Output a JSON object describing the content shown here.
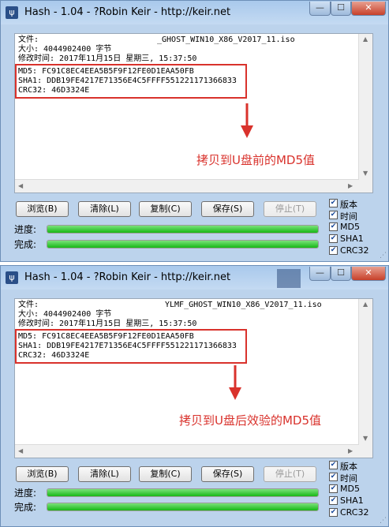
{
  "colors": {
    "annotation": "#d9322c",
    "progress": "#16b816",
    "titlebar": "#b7d1ef"
  },
  "windows": [
    {
      "title": "Hash - 1.04 - ?Robin Keir - http://keir.net",
      "output": {
        "file_label": "文件:",
        "file_name": "_GHOST_WIN10_X86_V2017_11.iso",
        "size_line": "大小: 4044902400 字节",
        "modified_line": "修改时间: 2017年11月15日 星期三, 15:37:50",
        "md5_line": "MD5: FC91C8EC4EEA5B5F9F12FE0D1EAA50FB",
        "sha1_line": "SHA1: DDB19FE4217E71356E4C5FFFF551221171366833",
        "crc32_line": "CRC32: 46D3324E"
      },
      "annotation": "拷贝到U盘前的MD5值",
      "buttons": [
        "浏览(B)",
        "清除(L)",
        "复制(C)",
        "保存(S)",
        "停止(T)"
      ],
      "progress_label": "进度:",
      "complete_label": "完成:",
      "progress": 1.0,
      "complete": 1.0,
      "options": [
        "版本",
        "时间",
        "MD5",
        "SHA1",
        "CRC32"
      ]
    },
    {
      "title": "Hash - 1.04 - ?Robin Keir - http://keir.net",
      "output": {
        "file_label": "文件:",
        "file_name": "YLMF_GHOST_WIN10_X86_V2017_11.iso",
        "size_line": "大小: 4044902400 字节",
        "modified_line": "修改时间: 2017年11月15日 星期三, 15:37:50",
        "md5_line": "MD5: FC91C8EC4EEA5B5F9F12FE0D1EAA50FB",
        "sha1_line": "SHA1: DDB19FE4217E71356E4C5FFFF551221171366833",
        "crc32_line": "CRC32: 46D3324E"
      },
      "annotation": "拷贝到U盘后效验的MD5值",
      "buttons": [
        "浏览(B)",
        "清除(L)",
        "复制(C)",
        "保存(S)",
        "停止(T)"
      ],
      "progress_label": "进度:",
      "complete_label": "完成:",
      "progress": 1.0,
      "complete": 1.0,
      "options": [
        "版本",
        "时间",
        "MD5",
        "SHA1",
        "CRC32"
      ]
    }
  ]
}
